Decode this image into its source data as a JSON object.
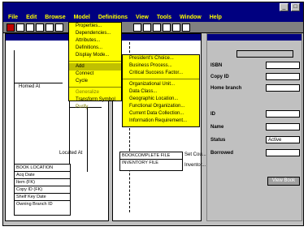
{
  "menubar": [
    "File",
    "Edit",
    "Browse",
    "Model",
    "Definitions",
    "View",
    "Tools",
    "Window",
    "Help"
  ],
  "menu_model": {
    "items": [
      "Properties...",
      "Dependencies...",
      "Attributes...",
      "Definitions...",
      "Display Mode...",
      "Add",
      "Connect",
      "Cycle",
      "Generalize",
      "Transform Symbol",
      "Purify"
    ]
  },
  "menu_add": {
    "items": [
      "President's Choice...",
      "Business Process...",
      "Critical Success Factor...",
      "Organizational Unit...",
      "Data Class...",
      "Geographic Location...",
      "Functional Organization...",
      "Current Data Collection...",
      "Information Requirement..."
    ]
  },
  "diagram": {
    "label_homed": "Homed At",
    "label_located": "Located At",
    "entity_title": "BOOK LOCATION",
    "entity_rows": [
      "Acq Date",
      "Item (FK)",
      "Copy ID (FK)",
      "Shelf Key Date",
      "Owning Branch ID"
    ],
    "file_rows": [
      "BOOKCOMPLETE FILE",
      "INVENTORY FILE"
    ],
    "label_set": "Set Cou...",
    "label_inventory": "Inventor..."
  },
  "form": {
    "fields": [
      {
        "label": "ISBN",
        "value": ""
      },
      {
        "label": "Copy ID",
        "value": ""
      },
      {
        "label": "Home branch",
        "value": ""
      },
      {
        "label": "ID",
        "value": ""
      },
      {
        "label": "Name",
        "value": ""
      },
      {
        "label": "Status",
        "value": "Active"
      },
      {
        "label": "Borrowed",
        "value": ""
      }
    ],
    "button": "View Book"
  }
}
